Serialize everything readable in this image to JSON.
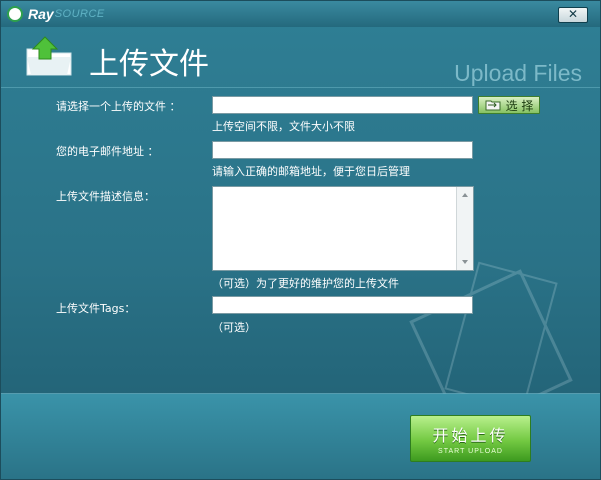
{
  "app": {
    "logo_ray": "Ray",
    "logo_source": "SOURCE"
  },
  "window": {
    "close_glyph": "✕"
  },
  "header": {
    "title": "上传文件",
    "subtitle": "Upload Files"
  },
  "form": {
    "file": {
      "label": "请选择一个上传的文件 ：",
      "value": "",
      "hint": "上传空间不限，文件大小不限",
      "button_label": "选 择"
    },
    "email": {
      "label": "您的电子邮件地址 ：",
      "value": "",
      "hint": "请输入正确的邮箱地址，便于您日后管理"
    },
    "description": {
      "label": "上传文件描述信息：",
      "value": "",
      "hint": "（可选）为了更好的维护您的上传文件"
    },
    "tags": {
      "label": "上传文件Tags：",
      "value": "",
      "hint": "（可选）"
    }
  },
  "actions": {
    "start_main": "开始上传",
    "start_sub": "START UPLOAD"
  },
  "colors": {
    "accent": "#2f7f95",
    "button_green": "#73c942"
  },
  "icons": {
    "logo": "raysource-logo-icon",
    "header": "upload-folder-icon",
    "select": "folder-icon"
  }
}
